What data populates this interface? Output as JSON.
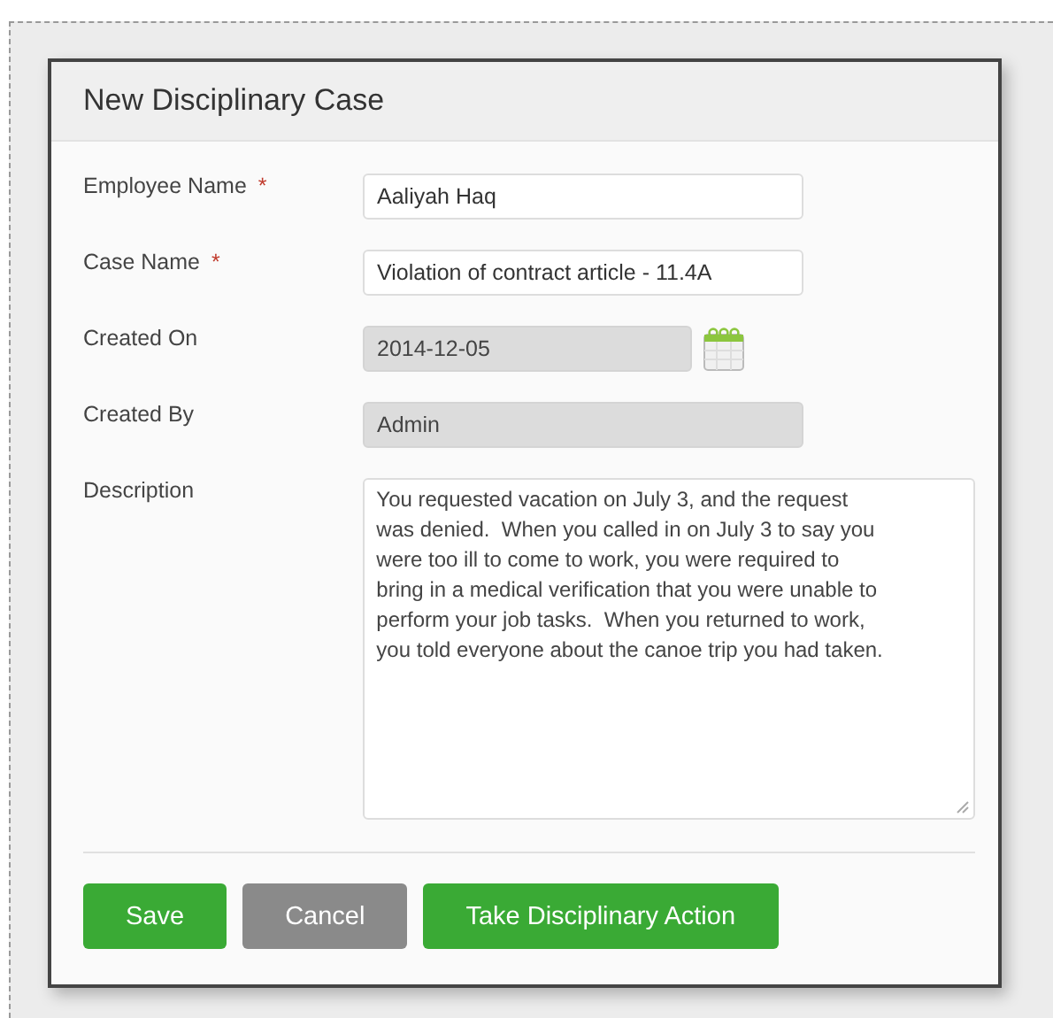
{
  "dialog": {
    "title": "New Disciplinary Case"
  },
  "fields": [
    {
      "kind": "text",
      "label": "Employee Name",
      "required_mark": "*",
      "value": "Aaliyah Haq",
      "disabled": false
    },
    {
      "kind": "text",
      "label": "Case Name",
      "required_mark": "*",
      "value": "Violation of  contract article - 11.4A",
      "disabled": false
    },
    {
      "kind": "date",
      "label": "Created On",
      "value": "2014-12-05",
      "disabled": true
    },
    {
      "kind": "text",
      "label": "Created By",
      "value": "Admin",
      "disabled": true
    },
    {
      "kind": "textarea",
      "label": "Description",
      "value": "You requested vacation on July 3, and the request\nwas denied.  When you called in on July 3 to say you\nwere too ill to come to work, you were required to\nbring in a medical verification that you were unable to\nperform your job tasks.  When you returned to work,\nyou told everyone about the canoe trip you had taken.",
      "disabled": false
    }
  ],
  "buttons": [
    {
      "label": "Save",
      "kind": "primary"
    },
    {
      "label": "Cancel",
      "kind": "secondary"
    },
    {
      "label": "Take Disciplinary Action",
      "kind": "primary"
    }
  ]
}
